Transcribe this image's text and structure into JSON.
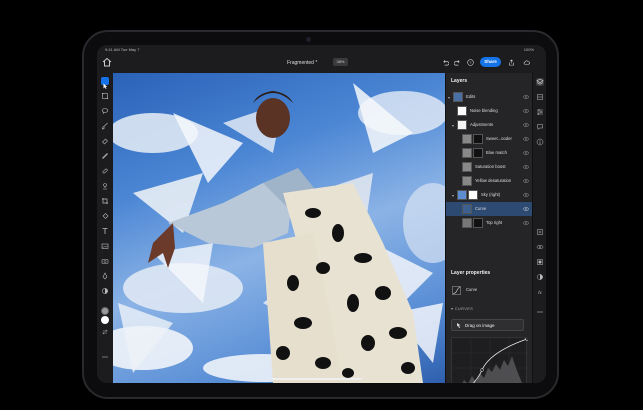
{
  "status": {
    "time": "9:41 AM",
    "date": "Tue May 7",
    "battery": "100%"
  },
  "document": {
    "title": "Fragmented *",
    "zoom": "38%"
  },
  "share_label": "Share",
  "layers": {
    "title": "Layers",
    "items": [
      {
        "name": "Edits",
        "indent": 0,
        "selected": false
      },
      {
        "name": "Noise blending",
        "indent": 1,
        "selected": false
      },
      {
        "name": "Adjustments",
        "indent": 1,
        "selected": false
      },
      {
        "name": "Sweet...ooder",
        "indent": 2,
        "selected": false
      },
      {
        "name": "Blue match",
        "indent": 2,
        "selected": false
      },
      {
        "name": "Saturation boost",
        "indent": 2,
        "selected": false
      },
      {
        "name": "Yellow desaturation",
        "indent": 2,
        "selected": false
      },
      {
        "name": "Sky (right)",
        "indent": 1,
        "selected": false
      },
      {
        "name": "Curve",
        "indent": 2,
        "selected": true
      },
      {
        "name": "Top right",
        "indent": 2,
        "selected": false
      }
    ]
  },
  "properties": {
    "title": "Layer properties",
    "layer_name": "Curve",
    "section_label": "CURVES",
    "drag_label": "Drag on image"
  },
  "colors": {
    "accent": "#1473e6",
    "red": "#e0413a",
    "green": "#31a24c",
    "blue": "#2680eb"
  }
}
